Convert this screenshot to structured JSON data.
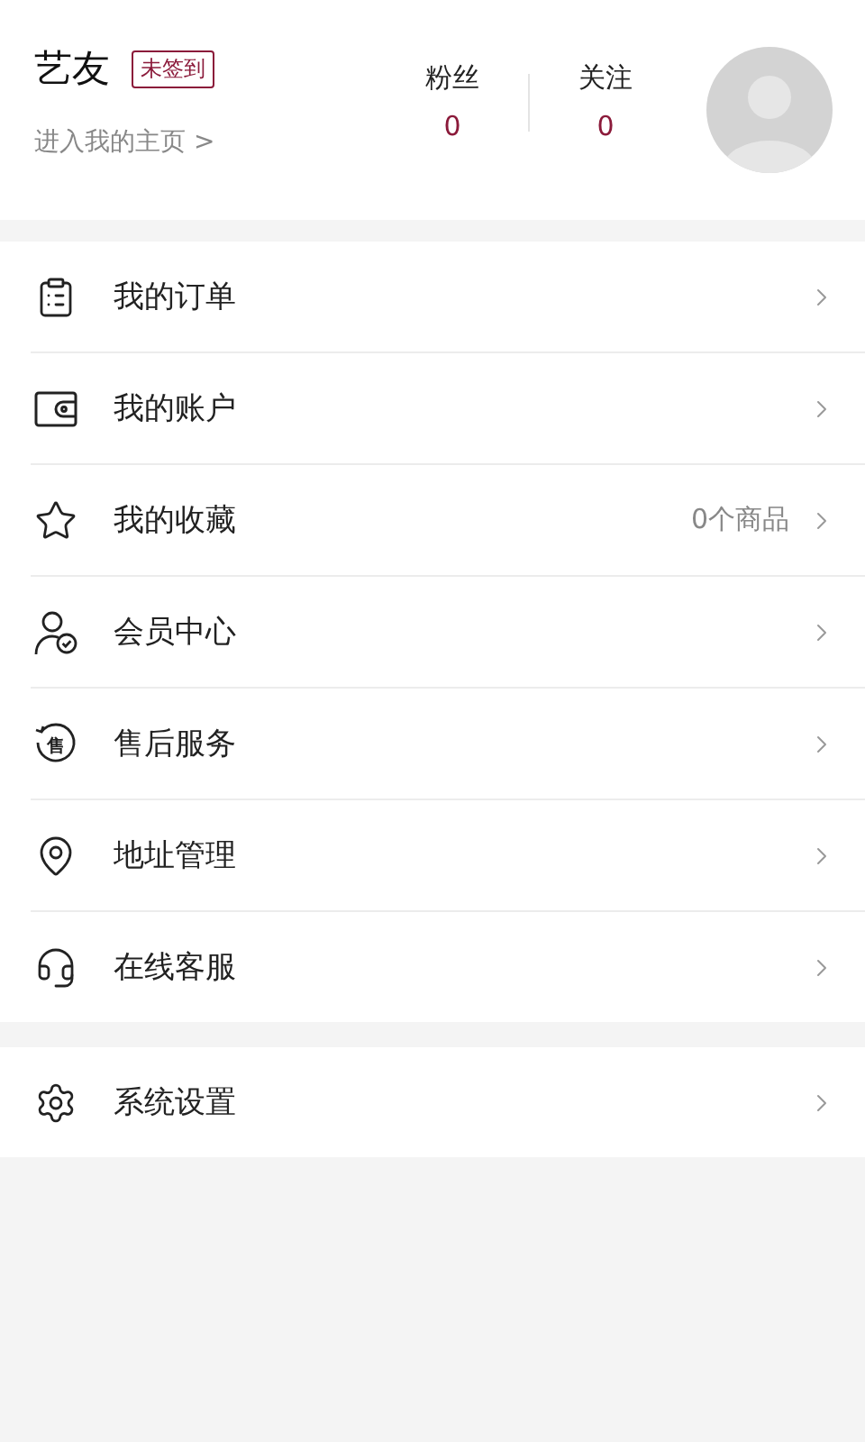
{
  "profile": {
    "name": "艺友",
    "sign_badge": "未签到",
    "home_link": "进入我的主页 >",
    "stats": [
      {
        "label": "粉丝",
        "value": "0"
      },
      {
        "label": "关注",
        "value": "0"
      }
    ]
  },
  "menu_groups": [
    {
      "items": [
        {
          "kind": "order",
          "label": "我的订单"
        },
        {
          "kind": "wallet",
          "label": "我的账户"
        },
        {
          "kind": "star",
          "label": "我的收藏",
          "detail": "0个商品"
        },
        {
          "kind": "member",
          "label": "会员中心"
        },
        {
          "kind": "aftersale",
          "label": "售后服务",
          "icon_label": "售"
        },
        {
          "kind": "location",
          "label": "地址管理"
        },
        {
          "kind": "service",
          "label": "在线客服"
        }
      ]
    },
    {
      "items": [
        {
          "kind": "settings",
          "label": "系统设置"
        }
      ]
    }
  ]
}
